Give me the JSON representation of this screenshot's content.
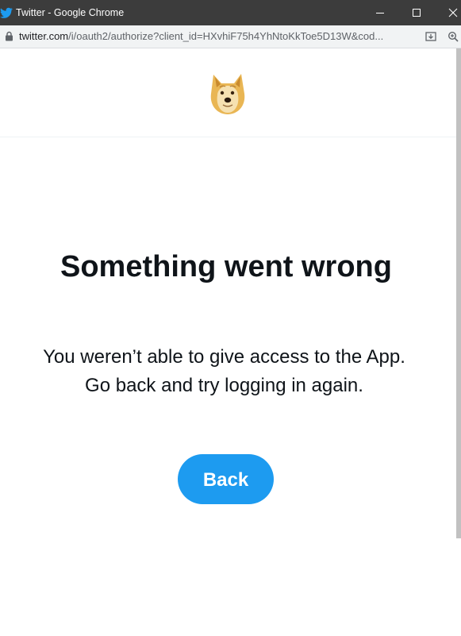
{
  "window": {
    "title": "Twitter - Google Chrome",
    "icon": "twitter-bird-icon",
    "controls": [
      "minimize-icon",
      "maximize-icon",
      "close-icon"
    ]
  },
  "address_bar": {
    "host": "twitter.com",
    "path": "/i/oauth2/authorize?client_id=HXvhiF75h4YhNtoKkToe5D13W&cod..."
  },
  "page": {
    "logo": "doge-logo",
    "heading": "Something went wrong",
    "message_line1": "You weren’t able to give access to the App.",
    "message_line2": "Go back and try logging in again.",
    "back_button": "Back"
  },
  "colors": {
    "accent": "#1d9bf0",
    "text": "#0f1419",
    "titlebar": "#3c3c3c"
  }
}
